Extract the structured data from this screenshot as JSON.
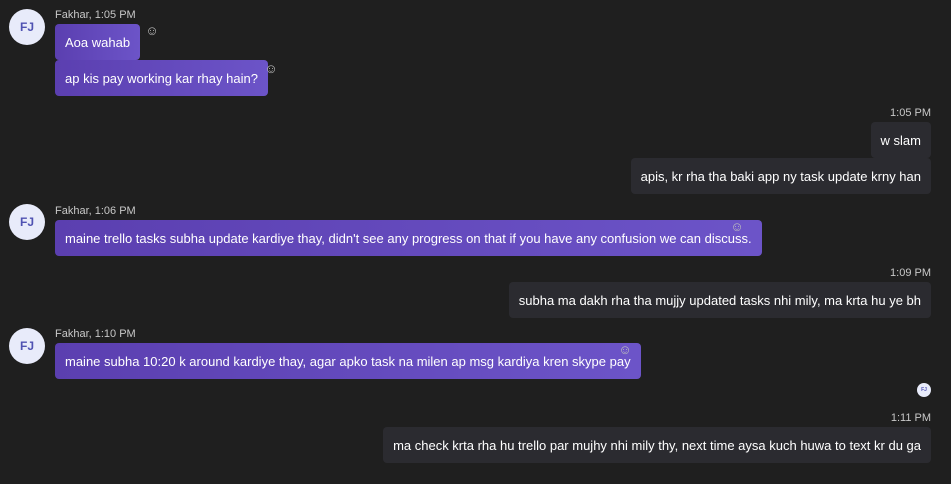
{
  "messages": [
    {
      "sender_initials": "FJ",
      "meta": "Fakhar, 1:05 PM",
      "texts": [
        "Aoa wahab",
        "ap kis pay working kar rhay hain?"
      ]
    },
    {
      "meta": "1:05 PM",
      "texts": [
        "w slam",
        "apis, kr rha tha baki app ny task update krny han"
      ]
    },
    {
      "sender_initials": "FJ",
      "meta": "Fakhar, 1:06 PM",
      "texts": [
        "maine trello tasks subha update kardiye thay, didn't see any progress on that if you have any confusion we can discuss."
      ]
    },
    {
      "meta": "1:09 PM",
      "texts": [
        "subha ma dakh rha tha mujjy updated tasks nhi mily, ma krta hu ye bh"
      ]
    },
    {
      "sender_initials": "FJ",
      "meta": "Fakhar, 1:10 PM",
      "texts": [
        "maine subha 10:20 k around kardiye thay, agar apko task na milen ap msg kardiya kren skype pay"
      ]
    },
    {
      "meta": "1:11 PM",
      "texts": [
        "ma check krta rha hu trello par mujhy nhi mily thy,  next time aysa kuch huwa to text  kr du ga"
      ]
    }
  ],
  "reaction_icon": "☺",
  "seen_initials": "FJ",
  "colors": {
    "background": "#1f1f1f",
    "incoming_bubble_start": "#5b3fb0",
    "incoming_bubble_end": "#6c54c8",
    "outgoing_bubble": "#2b2b30",
    "avatar_bg": "#e8ebfa",
    "avatar_text": "#4f52b2"
  }
}
